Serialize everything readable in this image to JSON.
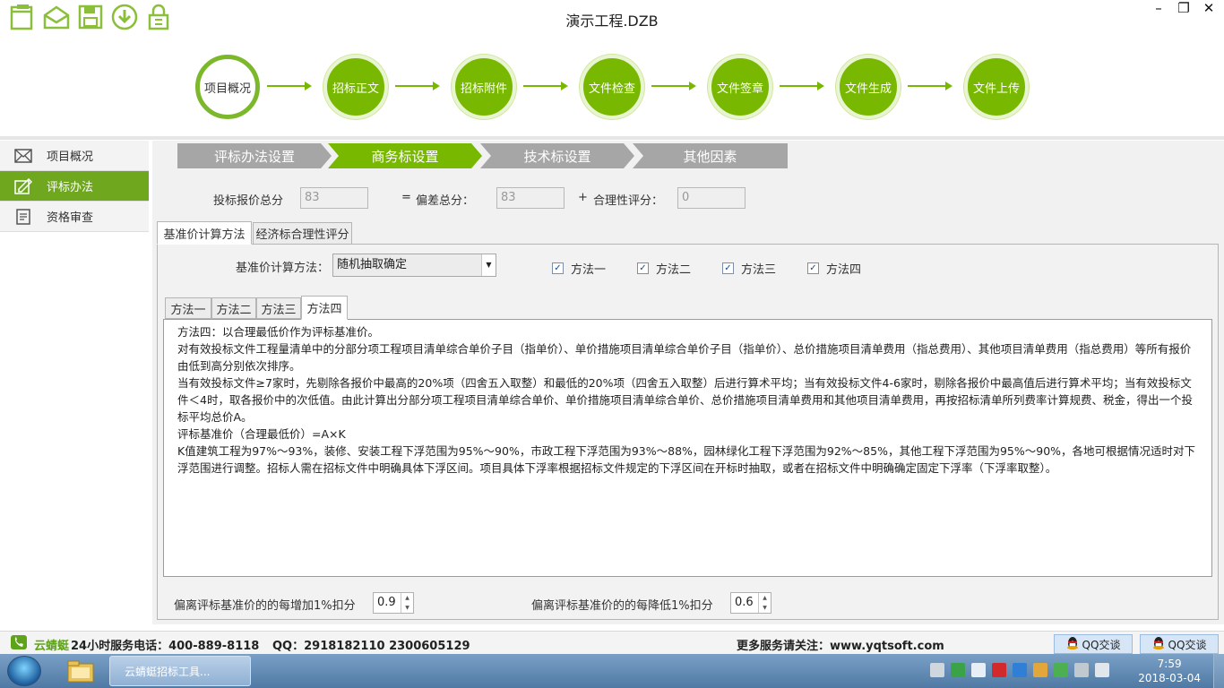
{
  "app": {
    "title": "演示工程.DZB",
    "window_controls": {
      "minimize": "–",
      "restore": "❐",
      "close": "✕"
    }
  },
  "toolbar": {
    "icons": [
      "new-file-icon",
      "open-mail-icon",
      "save-icon",
      "download-icon",
      "lock-icon"
    ]
  },
  "steps": [
    {
      "label": "项目概况"
    },
    {
      "label": "招标正文"
    },
    {
      "label": "招标附件"
    },
    {
      "label": "文件检查"
    },
    {
      "label": "文件签章"
    },
    {
      "label": "文件生成"
    },
    {
      "label": "文件上传"
    }
  ],
  "sidebar": {
    "items": [
      {
        "label": "项目概况",
        "icon": "mail-icon"
      },
      {
        "label": "评标办法",
        "icon": "edit-icon"
      },
      {
        "label": "资格审查",
        "icon": "document-icon"
      }
    ]
  },
  "ribbon_tabs": [
    {
      "label": "评标办法设置"
    },
    {
      "label": "商务标设置"
    },
    {
      "label": "技术标设置"
    },
    {
      "label": "其他因素"
    }
  ],
  "scores": {
    "bid_total_label": "投标报价总分",
    "bid_total_value": "83",
    "equals": "=",
    "deviation_label": "偏差总分：",
    "deviation_value": "83",
    "plus": "+",
    "rationality_label": "合理性评分：",
    "rationality_value": "0"
  },
  "inner_tabs": [
    {
      "label": "基准价计算方法"
    },
    {
      "label": "经济标合理性评分"
    }
  ],
  "method": {
    "label": "基准价计算方法：",
    "selected": "随机抽取确定",
    "checkboxes": [
      {
        "label": "方法一",
        "checked": "✓"
      },
      {
        "label": "方法二",
        "checked": "✓"
      },
      {
        "label": "方法三",
        "checked": "✓"
      },
      {
        "label": "方法四",
        "checked": "✓"
      }
    ]
  },
  "method_tabs": [
    {
      "label": "方法一"
    },
    {
      "label": "方法二"
    },
    {
      "label": "方法三"
    },
    {
      "label": "方法四"
    }
  ],
  "method_text": {
    "line1": "方法四：以合理最低价作为评标基准价。",
    "line2": "对有效投标文件工程量清单中的分部分项工程项目清单综合单价子目（指单价）、单价措施项目清单综合单价子目（指单价）、总价措施项目清单费用（指总费用）、其他项目清单费用（指总费用）等所有报价由低到高分别依次排序。",
    "line3": "当有效投标文件≥7家时，先剔除各报价中最高的20%项（四舍五入取整）和最低的20%项（四舍五入取整）后进行算术平均；当有效投标文件4-6家时，剔除各报价中最高值后进行算术平均；当有效投标文件＜4时，取各报价中的次低值。由此计算出分部分项工程项目清单综合单价、单价措施项目清单综合单价、总价措施项目清单费用和其他项目清单费用，再按招标清单所列费率计算规费、税金，得出一个投标平均总价A。",
    "line4": "评标基准价（合理最低价）=A×K",
    "line5": "K值建筑工程为97%～93%，装修、安装工程下浮范围为95%～90%，市政工程下浮范围为93%～88%，园林绿化工程下浮范围为92%～85%，其他工程下浮范围为95%～90%，各地可根据情况适时对下浮范围进行调整。招标人需在招标文件中明确具体下浮区间。项目具体下浮率根据招标文件规定的下浮区间在开标时抽取，或者在招标文件中明确确定固定下浮率（下浮率取整）。"
  },
  "deductions": {
    "increase_label": "偏离评标基准价的的每增加1%扣分",
    "increase_value": "0.9",
    "decrease_label": "偏离评标基准价的的每降低1%扣分",
    "decrease_value": "0.6"
  },
  "status_bar": {
    "brand": "云蜻蜓",
    "hotline": "24小时服务电话：400-889-8118",
    "qq": "QQ：2918182110  2300605129",
    "website": "更多服务请关注：www.yqtsoft.com",
    "qq_button_1": "QQ交谈",
    "qq_button_2": "QQ交谈"
  },
  "taskbar": {
    "app_label": "云蜻蜓招标工具...",
    "time": "7:59",
    "date": "2018-03-04"
  },
  "colors": {
    "accent_green": "#79b800",
    "tab_gray": "#a6a6a6",
    "taskbar_blue": "#4f79a4"
  }
}
